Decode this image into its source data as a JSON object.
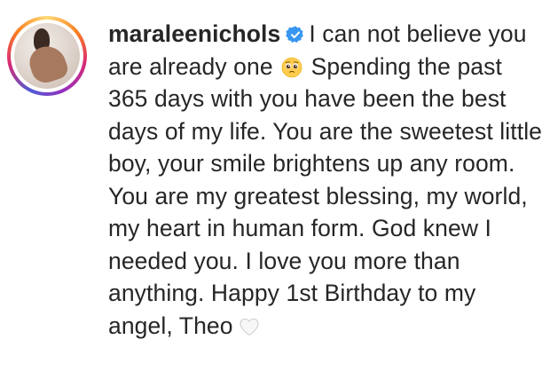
{
  "comment": {
    "username": "maraleenichols",
    "verified_icon": "verified-badge-icon",
    "caption_part1": "I can not believe you are already one",
    "emoji_1": "pleading-face-emoji",
    "caption_part2": "Spending the past 365 days with you have been the best days of my life. You are the sweetest little boy, your smile brightens up any room.\nYou are my greatest blessing, my world, my heart in human form. God knew I needed you. I love you more than anything. Happy 1st Birthday to my angel, Theo",
    "emoji_2": "white-heart-emoji"
  },
  "colors": {
    "text": "#262626",
    "verified": "#3897f0",
    "ring_start": "#feda75",
    "ring_end": "#962fbf"
  }
}
